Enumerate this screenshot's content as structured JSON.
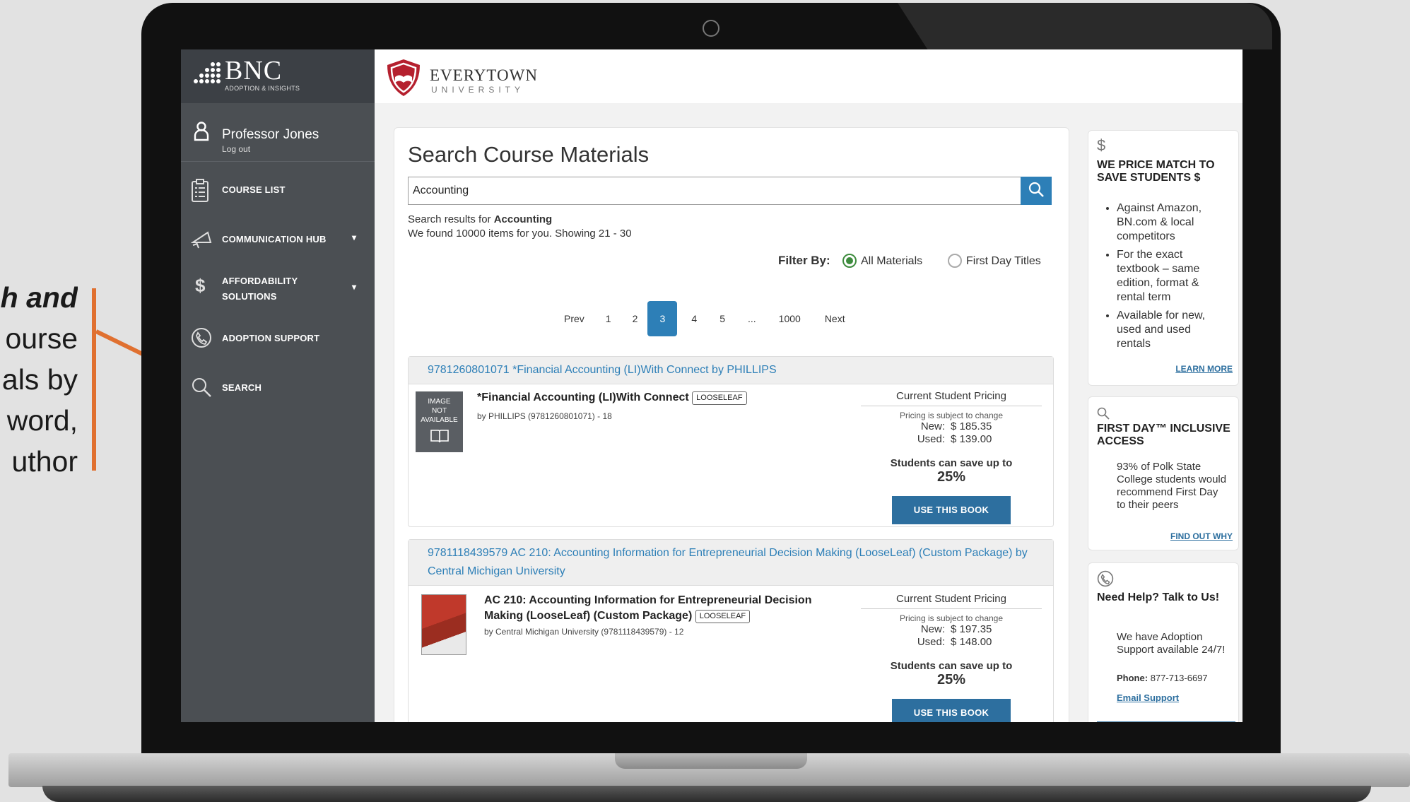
{
  "callout": {
    "lines": [
      "h and",
      "ourse",
      "als by",
      "word,",
      "uthor"
    ]
  },
  "sidebar": {
    "brand_title": "BNC",
    "brand_subtitle": "ADOPTION & INSIGHTS",
    "user_name": "Professor Jones",
    "logout_label": "Log out",
    "items": [
      {
        "label": "COURSE LIST",
        "icon": "clipboard-icon"
      },
      {
        "label": "COMMUNICATION HUB",
        "icon": "megaphone-icon",
        "caret": "▾"
      },
      {
        "label": "AFFORDABILITY SOLUTIONS",
        "icon": "dollar-icon",
        "caret": "▾"
      },
      {
        "label": "ADOPTION SUPPORT",
        "icon": "phone-icon"
      },
      {
        "label": "SEARCH",
        "icon": "search-icon"
      }
    ]
  },
  "header": {
    "school_name": "EVERYTOWN",
    "school_sub": "UNIVERSITY"
  },
  "main": {
    "title": "Search Course Materials",
    "search_value": "Accounting",
    "results_prefix": "Search results for ",
    "results_term": "Accounting",
    "results_count": "We found 10000 items for you. Showing 21 - 30",
    "filter_label": "Filter By:",
    "filter_options": [
      {
        "label": "All Materials",
        "selected": true
      },
      {
        "label": "First Day Titles",
        "selected": false
      }
    ],
    "pager": [
      "Prev",
      "1",
      "2",
      "3",
      "4",
      "5",
      "...",
      "1000",
      "Next"
    ],
    "current_page": "3",
    "results": [
      {
        "header": "9781260801071  *Financial Accounting (LI)With Connect by PHILLIPS",
        "title": "*Financial Accounting (LI)With Connect",
        "format": "LOOSELEAF",
        "meta": "by PHILLIPS (9781260801071) - 18",
        "image_text": "IMAGE NOT AVAILABLE",
        "pricing_head": "Current Student Pricing",
        "pricing_note": "Pricing is subject to change",
        "new_label": "New:",
        "new_price": "$ 185.35",
        "used_label": "Used:",
        "used_price": "$ 139.00",
        "save_label": "Students can save up to",
        "save_pct": "25%",
        "button": "USE THIS BOOK"
      },
      {
        "header": "9781118439579  AC 210: Accounting Information for Entrepreneurial Decision Making (LooseLeaf) (Custom Package) by Central Michigan University",
        "title": "AC 210: Accounting Information for Entrepreneurial Decision Making (LooseLeaf) (Custom Package)",
        "format": "LOOSELEAF",
        "meta": "by Central Michigan University (9781118439579) - 12",
        "pricing_head": "Current Student Pricing",
        "pricing_note": "Pricing is subject to change",
        "new_label": "New:",
        "new_price": "$ 197.35",
        "used_label": "Used:",
        "used_price": "$ 148.00",
        "save_label": "Students can save up to",
        "save_pct": "25%",
        "button": "USE THIS BOOK"
      }
    ]
  },
  "side_panels": {
    "price_match": {
      "icon_char": "$",
      "title": "WE PRICE MATCH TO SAVE STUDENTS $",
      "bullets": [
        "Against Amazon, BN.com & local competitors",
        "For the exact textbook – same edition, format & rental term",
        "Available for new, used and used rentals"
      ],
      "link": "LEARN MORE"
    },
    "first_day": {
      "title": "FIRST DAY™ INCLUSIVE ACCESS",
      "text": "93% of Polk State College students would recommend First Day to their peers",
      "link": "FIND OUT WHY"
    },
    "help": {
      "title": "Need Help? Talk to Us!",
      "text": "We have Adoption Support available 24/7!",
      "phone_label": "Phone:",
      "phone": "877-713-6697",
      "email_link": "Email Support"
    }
  },
  "colors": {
    "sidebar": "#4b4f53",
    "accent_blue": "#2d7fb7",
    "callout_orange": "#e07030",
    "radio_green": "#3d8b3d",
    "shield_red": "#b5202e"
  }
}
